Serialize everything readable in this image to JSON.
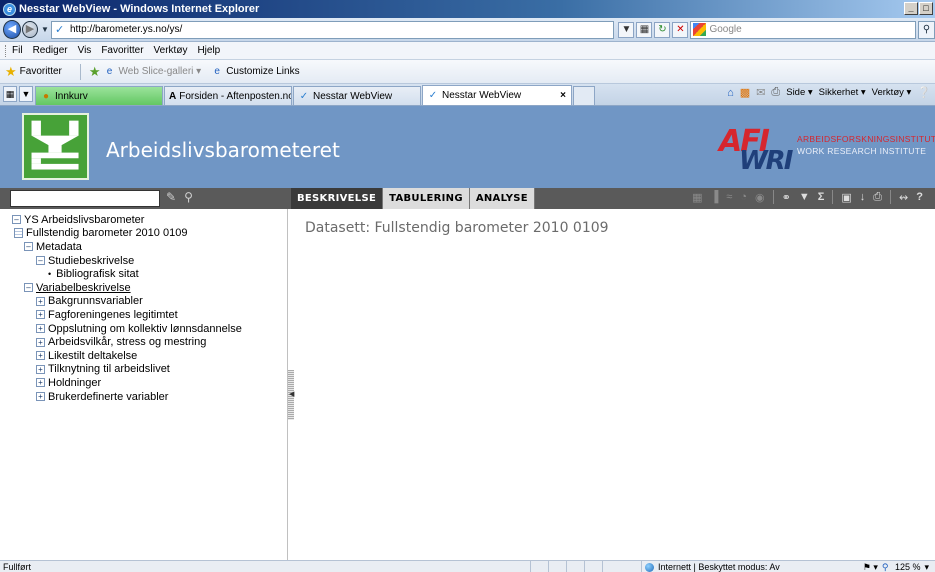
{
  "window": {
    "title": "Nesstar WebView - Windows Internet Explorer",
    "controls": [
      "_",
      "□",
      "×"
    ]
  },
  "addressbar": {
    "url": "http://barometer.ys.no/ys/",
    "search_placeholder": "Google"
  },
  "menu": {
    "items": [
      "Fil",
      "Rediger",
      "Vis",
      "Favoritter",
      "Verktøy",
      "Hjelp"
    ]
  },
  "favorites": {
    "label": "Favoritter",
    "items": [
      "Web Slice-galleri ▾",
      "Customize Links"
    ]
  },
  "tabs": {
    "items": [
      {
        "label": "Innkurv"
      },
      {
        "label": "Forsiden - Aftenposten.no"
      },
      {
        "label": "Nesstar WebView"
      },
      {
        "label": "Nesstar WebView"
      }
    ],
    "close": "×"
  },
  "commandbar": {
    "side": "Side ▾",
    "sikkerhet": "Sikkerhet ▾",
    "verktoy": "Verktøy ▾"
  },
  "banner": {
    "title": "Arbeidslivsbarometeret",
    "logo_letters": "YS",
    "afi_mark": "AFI",
    "wri_mark": "WRI",
    "afi_name": "ARBEIDSFORSKNINGSINSTITUTTET",
    "wri_name": "WORK RESEARCH INSTITUTE"
  },
  "nav": {
    "tabs": [
      "BESKRIVELSE",
      "TABULERING",
      "ANALYSE"
    ]
  },
  "tree": {
    "root": "YS Arbeidslivsbarometer",
    "dataset": "Fullstendig barometer 2010 0109",
    "metadata": "Metadata",
    "studiebeskrivelse": "Studiebeskrivelse",
    "bibliografisk": "Bibliografisk sitat",
    "variabelbeskrivelse": "Variabelbeskrivelse",
    "groups": [
      "Bakgrunnsvariabler",
      "Fagforeningenes legitimtet",
      "Oppslutning om kollektiv lønnsdannelse",
      "Arbeidsvilkår, stress og mestring",
      "Likestilt deltakelse",
      "Tilknytning til arbeidslivet",
      "Holdninger",
      "Brukerdefinerte variabler"
    ]
  },
  "main": {
    "heading": "Datasett: Fullstendig barometer 2010 0109"
  },
  "status": {
    "left": "Fullført",
    "zone": "Internett | Beskyttet modus: Av",
    "zoom": " 125 %"
  }
}
